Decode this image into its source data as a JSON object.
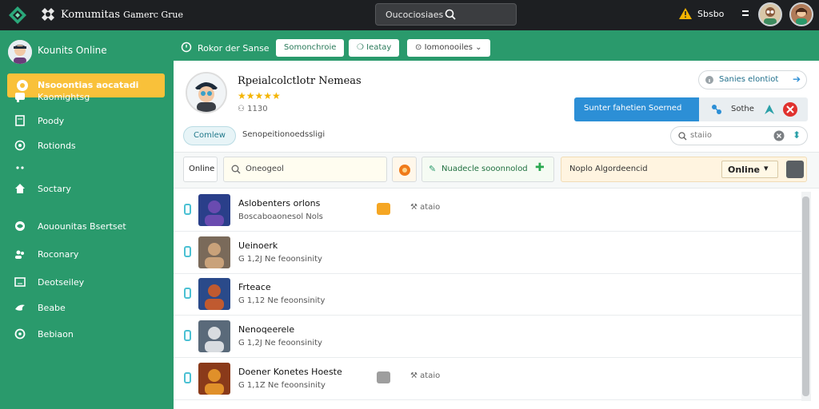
{
  "topbar": {
    "brand": "Komumitas",
    "brand_sub": "Gamerc Grue",
    "search_query": "Oucociosiaes",
    "alert_text": "Sbsbo"
  },
  "sidebar": {
    "user_label": "Kounits Online",
    "active_item": "Nsooontias aocatadi",
    "items": [
      {
        "label": "Kaomightsg",
        "icon": "chat-bubble-icon"
      },
      {
        "label": "Poody",
        "icon": "document-icon"
      },
      {
        "label": "Rotionds",
        "icon": "circle-target-icon"
      },
      {
        "label": "",
        "icon": "dots-icon"
      },
      {
        "label": "Soctary",
        "icon": "home-icon"
      },
      {
        "label": "Aouounitas Bsertset",
        "icon": "globe-icon"
      },
      {
        "label": "Roconary",
        "icon": "users-icon"
      },
      {
        "label": "Deotseiley",
        "icon": "grid-icon"
      },
      {
        "label": "Beabe",
        "icon": "bird-icon"
      },
      {
        "label": "Bebiaon",
        "icon": "settings-icon"
      }
    ]
  },
  "tabstrip": {
    "label": "Rokor der Sanse",
    "pills": [
      "Somonchroie",
      "Ieatay",
      "Iomonooiles"
    ]
  },
  "profile": {
    "title": "Rpeialcolctlotr Nemeas",
    "rating": 5,
    "count": "1130",
    "follow_label": "Sanies elontiot",
    "primary_button": "Sunter fahetien Soerned",
    "group_label": "Sothe",
    "tag_chip": "Comlew",
    "subtitle": "Senopeitionoedssligi",
    "mini_search_placeholder": "staiio"
  },
  "filters": {
    "status_label": "Online",
    "search_placeholder": "Oneogeol",
    "green_label": "Nuadecle sooonnolod",
    "orange_label": "Noplo Algordeencid",
    "dropdown_value": "Online"
  },
  "rows": [
    {
      "title": "Aslobenters orlons",
      "sub": "Boscaboaonesol Nols",
      "extra": "ataio",
      "badge_color": "#f5a623"
    },
    {
      "title": "Ueinoerk",
      "sub": "G 1,2J Ne feoonsinity",
      "extra": "",
      "badge_color": ""
    },
    {
      "title": "Frteace",
      "sub": "G 1,12 Ne feoonsinity",
      "extra": "",
      "badge_color": ""
    },
    {
      "title": "Nenoqeerele",
      "sub": "G 1,2J Ne feoonsinity",
      "extra": "",
      "badge_color": ""
    },
    {
      "title": "Doener Konetes Hoeste",
      "sub": "G 1,1Z Ne feoonsinity",
      "extra": "ataio",
      "badge_color": "#9e9e9e"
    }
  ],
  "colors": {
    "sidebar_green": "#2a9a6c",
    "accent_yellow": "#f9c13a",
    "primary_blue": "#2c8fd6",
    "topbar_dark": "#1d1f22"
  }
}
